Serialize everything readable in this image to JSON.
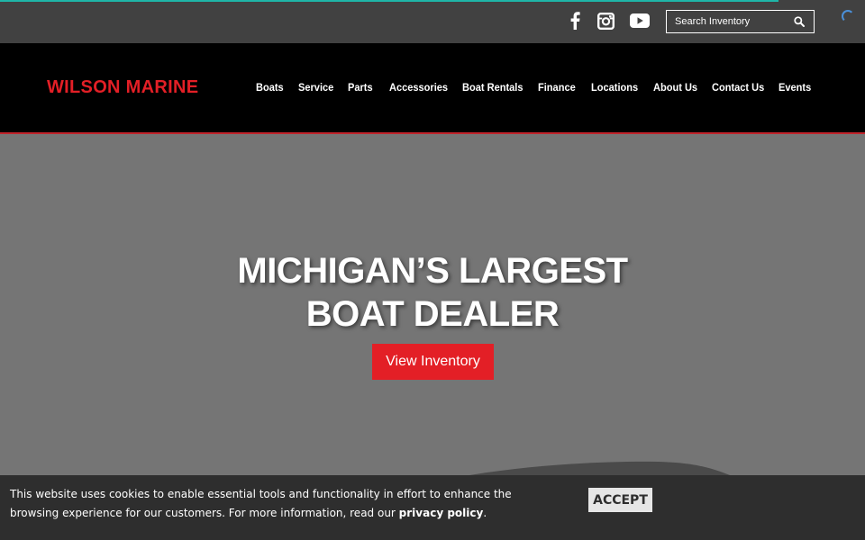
{
  "loading_progress": 0.9,
  "colors": {
    "brand_red": "#e31f26",
    "top_bar": "#414141",
    "nav_bg": "#000000",
    "hero_bg": "#757575",
    "cookie_bg": "#2e2e2e",
    "progress": "#1fb6a8"
  },
  "top_bar": {
    "social": [
      {
        "icon": "facebook-icon"
      },
      {
        "icon": "instagram-icon"
      },
      {
        "icon": "youtube-icon"
      }
    ],
    "search": {
      "placeholder": "Search Inventory",
      "icon": "search-icon"
    }
  },
  "header": {
    "logo": "WILSON MARINE",
    "nav": [
      {
        "label": "Boats"
      },
      {
        "label": "Service"
      },
      {
        "label": "Parts"
      },
      {
        "label": "Accessories"
      },
      {
        "label": "Boat Rentals"
      },
      {
        "label": "Finance"
      },
      {
        "label": "Locations"
      },
      {
        "label": "About Us"
      },
      {
        "label": "Contact Us"
      },
      {
        "label": "Events"
      }
    ]
  },
  "hero": {
    "title_line1": "MICHIGAN’S LARGEST",
    "title_line2": "BOAT DEALER",
    "cta": "View Inventory"
  },
  "cookie_banner": {
    "text": "This website uses cookies to enable essential tools and functionality in effort to enhance the browsing experience for our customers. For more information, read our ",
    "link": "privacy policy",
    "end": ".",
    "accept": "ACCEPT"
  }
}
